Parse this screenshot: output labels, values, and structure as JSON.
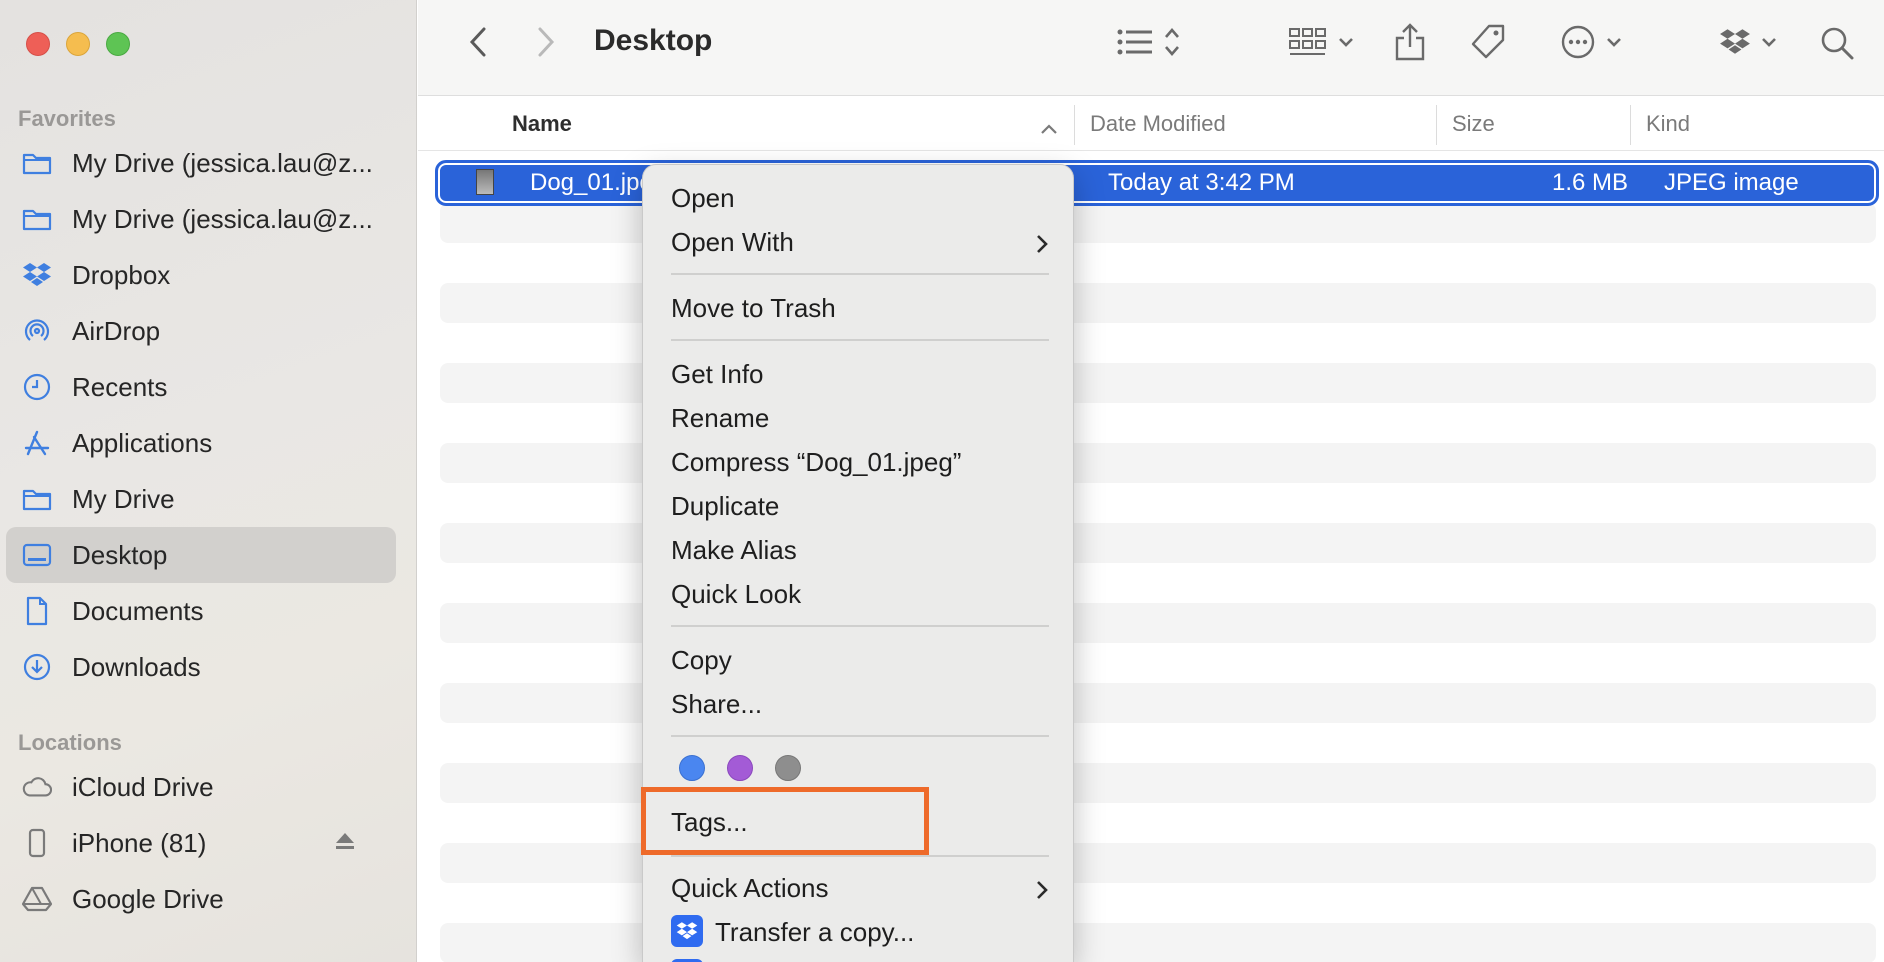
{
  "window": {
    "title": "Desktop"
  },
  "sidebar": {
    "favorites_title": "Favorites",
    "locations_title": "Locations",
    "favorites": [
      {
        "label": "My Drive (jessica.lau@z...",
        "icon": "folder-icon"
      },
      {
        "label": "My Drive (jessica.lau@z...",
        "icon": "folder-icon"
      },
      {
        "label": "Dropbox",
        "icon": "dropbox-icon"
      },
      {
        "label": "AirDrop",
        "icon": "airdrop-icon"
      },
      {
        "label": "Recents",
        "icon": "clock-icon"
      },
      {
        "label": "Applications",
        "icon": "applications-icon"
      },
      {
        "label": "My Drive",
        "icon": "folder-icon"
      },
      {
        "label": "Desktop",
        "icon": "desktop-icon",
        "selected": true
      },
      {
        "label": "Documents",
        "icon": "document-icon"
      },
      {
        "label": "Downloads",
        "icon": "download-icon"
      }
    ],
    "locations": [
      {
        "label": "iCloud Drive",
        "icon": "cloud-icon"
      },
      {
        "label": "iPhone (81)",
        "icon": "iphone-icon"
      },
      {
        "label": "Google Drive",
        "icon": "google-drive-icon"
      }
    ]
  },
  "columns": {
    "name": "Name",
    "date": "Date Modified",
    "size": "Size",
    "kind": "Kind"
  },
  "files": [
    {
      "name": "Dog_01.jpeg",
      "date": "Today at 3:42 PM",
      "size": "1.6 MB",
      "kind": "JPEG image"
    }
  ],
  "context_menu": {
    "open": "Open",
    "open_with": "Open With",
    "move_to_trash": "Move to Trash",
    "get_info": "Get Info",
    "rename": "Rename",
    "compress": "Compress “Dog_01.jpeg”",
    "duplicate": "Duplicate",
    "make_alias": "Make Alias",
    "quick_look": "Quick Look",
    "copy": "Copy",
    "share": "Share...",
    "tag_colors": [
      "#4a86f0",
      "#a35bd6",
      "#8e8e8e"
    ],
    "tags": "Tags...",
    "quick_actions": "Quick Actions",
    "transfer_copy": "Transfer a copy..."
  },
  "colors": {
    "selection": "#2a63d9",
    "highlight_box": "#ee6a2a"
  }
}
